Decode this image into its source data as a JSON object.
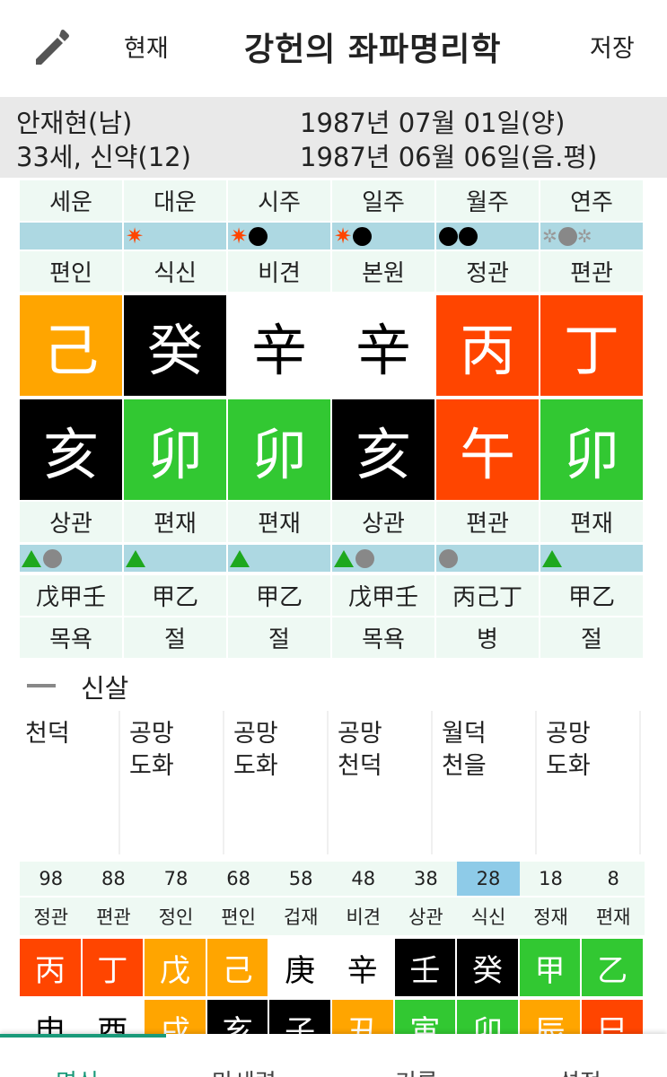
{
  "header": {
    "now_label": "현재",
    "title": "강헌의 좌파명리학",
    "save_label": "저장"
  },
  "person": {
    "name": "안재현(남)",
    "age_strength": "33세, 신약(12)",
    "solar_date": "1987년 07월 01일(양)",
    "lunar_date": "1987년 06월 06일(음.평)"
  },
  "pillars": {
    "headers": [
      "세운",
      "대운",
      "시주",
      "일주",
      "월주",
      "연주"
    ],
    "stem_gods": [
      "편인",
      "식신",
      "비견",
      "본원",
      "정관",
      "편관"
    ],
    "stems": [
      {
        "char": "己",
        "color": "#ffa500"
      },
      {
        "char": "癸",
        "color": "#000000"
      },
      {
        "char": "辛",
        "color": "#ffffff"
      },
      {
        "char": "辛",
        "color": "#ffffff"
      },
      {
        "char": "丙",
        "color": "#ff4500"
      },
      {
        "char": "丁",
        "color": "#ff4500"
      }
    ],
    "branches": [
      {
        "char": "亥",
        "color": "#000000"
      },
      {
        "char": "卯",
        "color": "#32c832"
      },
      {
        "char": "卯",
        "color": "#32c832"
      },
      {
        "char": "亥",
        "color": "#000000"
      },
      {
        "char": "午",
        "color": "#ff4500"
      },
      {
        "char": "卯",
        "color": "#32c832"
      }
    ],
    "branch_gods": [
      "상관",
      "편재",
      "편재",
      "상관",
      "편관",
      "편재"
    ],
    "hidden_stems": [
      "戊甲壬",
      "甲乙",
      "甲乙",
      "戊甲壬",
      "丙己丁",
      "甲乙"
    ],
    "stages": [
      "목욕",
      "절",
      "절",
      "목욕",
      "병",
      "절"
    ]
  },
  "shinsal": {
    "title": "신살",
    "columns": [
      [
        "천덕"
      ],
      [
        "공망",
        "도화"
      ],
      [
        "공망",
        "도화"
      ],
      [
        "공망",
        "천덕"
      ],
      [
        "월덕",
        "천을"
      ],
      [
        "공망",
        "도화"
      ]
    ]
  },
  "daeun": {
    "ages": [
      "98",
      "88",
      "78",
      "68",
      "58",
      "48",
      "38",
      "28",
      "18",
      "8"
    ],
    "selected_age": "28",
    "gods": [
      "정관",
      "편관",
      "정인",
      "편인",
      "겁재",
      "비견",
      "상관",
      "식신",
      "정재",
      "편재"
    ],
    "stems": [
      {
        "char": "丙",
        "color": "#ff4500"
      },
      {
        "char": "丁",
        "color": "#ff4500"
      },
      {
        "char": "戊",
        "color": "#ffa500"
      },
      {
        "char": "己",
        "color": "#ffa500"
      },
      {
        "char": "庚",
        "color": "#ffffff"
      },
      {
        "char": "辛",
        "color": "#ffffff"
      },
      {
        "char": "壬",
        "color": "#000000"
      },
      {
        "char": "癸",
        "color": "#000000"
      },
      {
        "char": "甲",
        "color": "#32c832"
      },
      {
        "char": "乙",
        "color": "#32c832"
      }
    ],
    "branches": [
      {
        "char": "申",
        "color": "#ffffff"
      },
      {
        "char": "酉",
        "color": "#ffffff"
      },
      {
        "char": "戌",
        "color": "#ffa500"
      },
      {
        "char": "亥",
        "color": "#000000"
      },
      {
        "char": "子",
        "color": "#000000"
      },
      {
        "char": "丑",
        "color": "#ffa500"
      },
      {
        "char": "寅",
        "color": "#32c832"
      },
      {
        "char": "卯",
        "color": "#32c832"
      },
      {
        "char": "辰",
        "color": "#ffa500"
      },
      {
        "char": "巳",
        "color": "#ff4500"
      }
    ]
  },
  "bottom_nav": {
    "tabs": [
      "명식",
      "만세력",
      "기록",
      "설정"
    ]
  }
}
